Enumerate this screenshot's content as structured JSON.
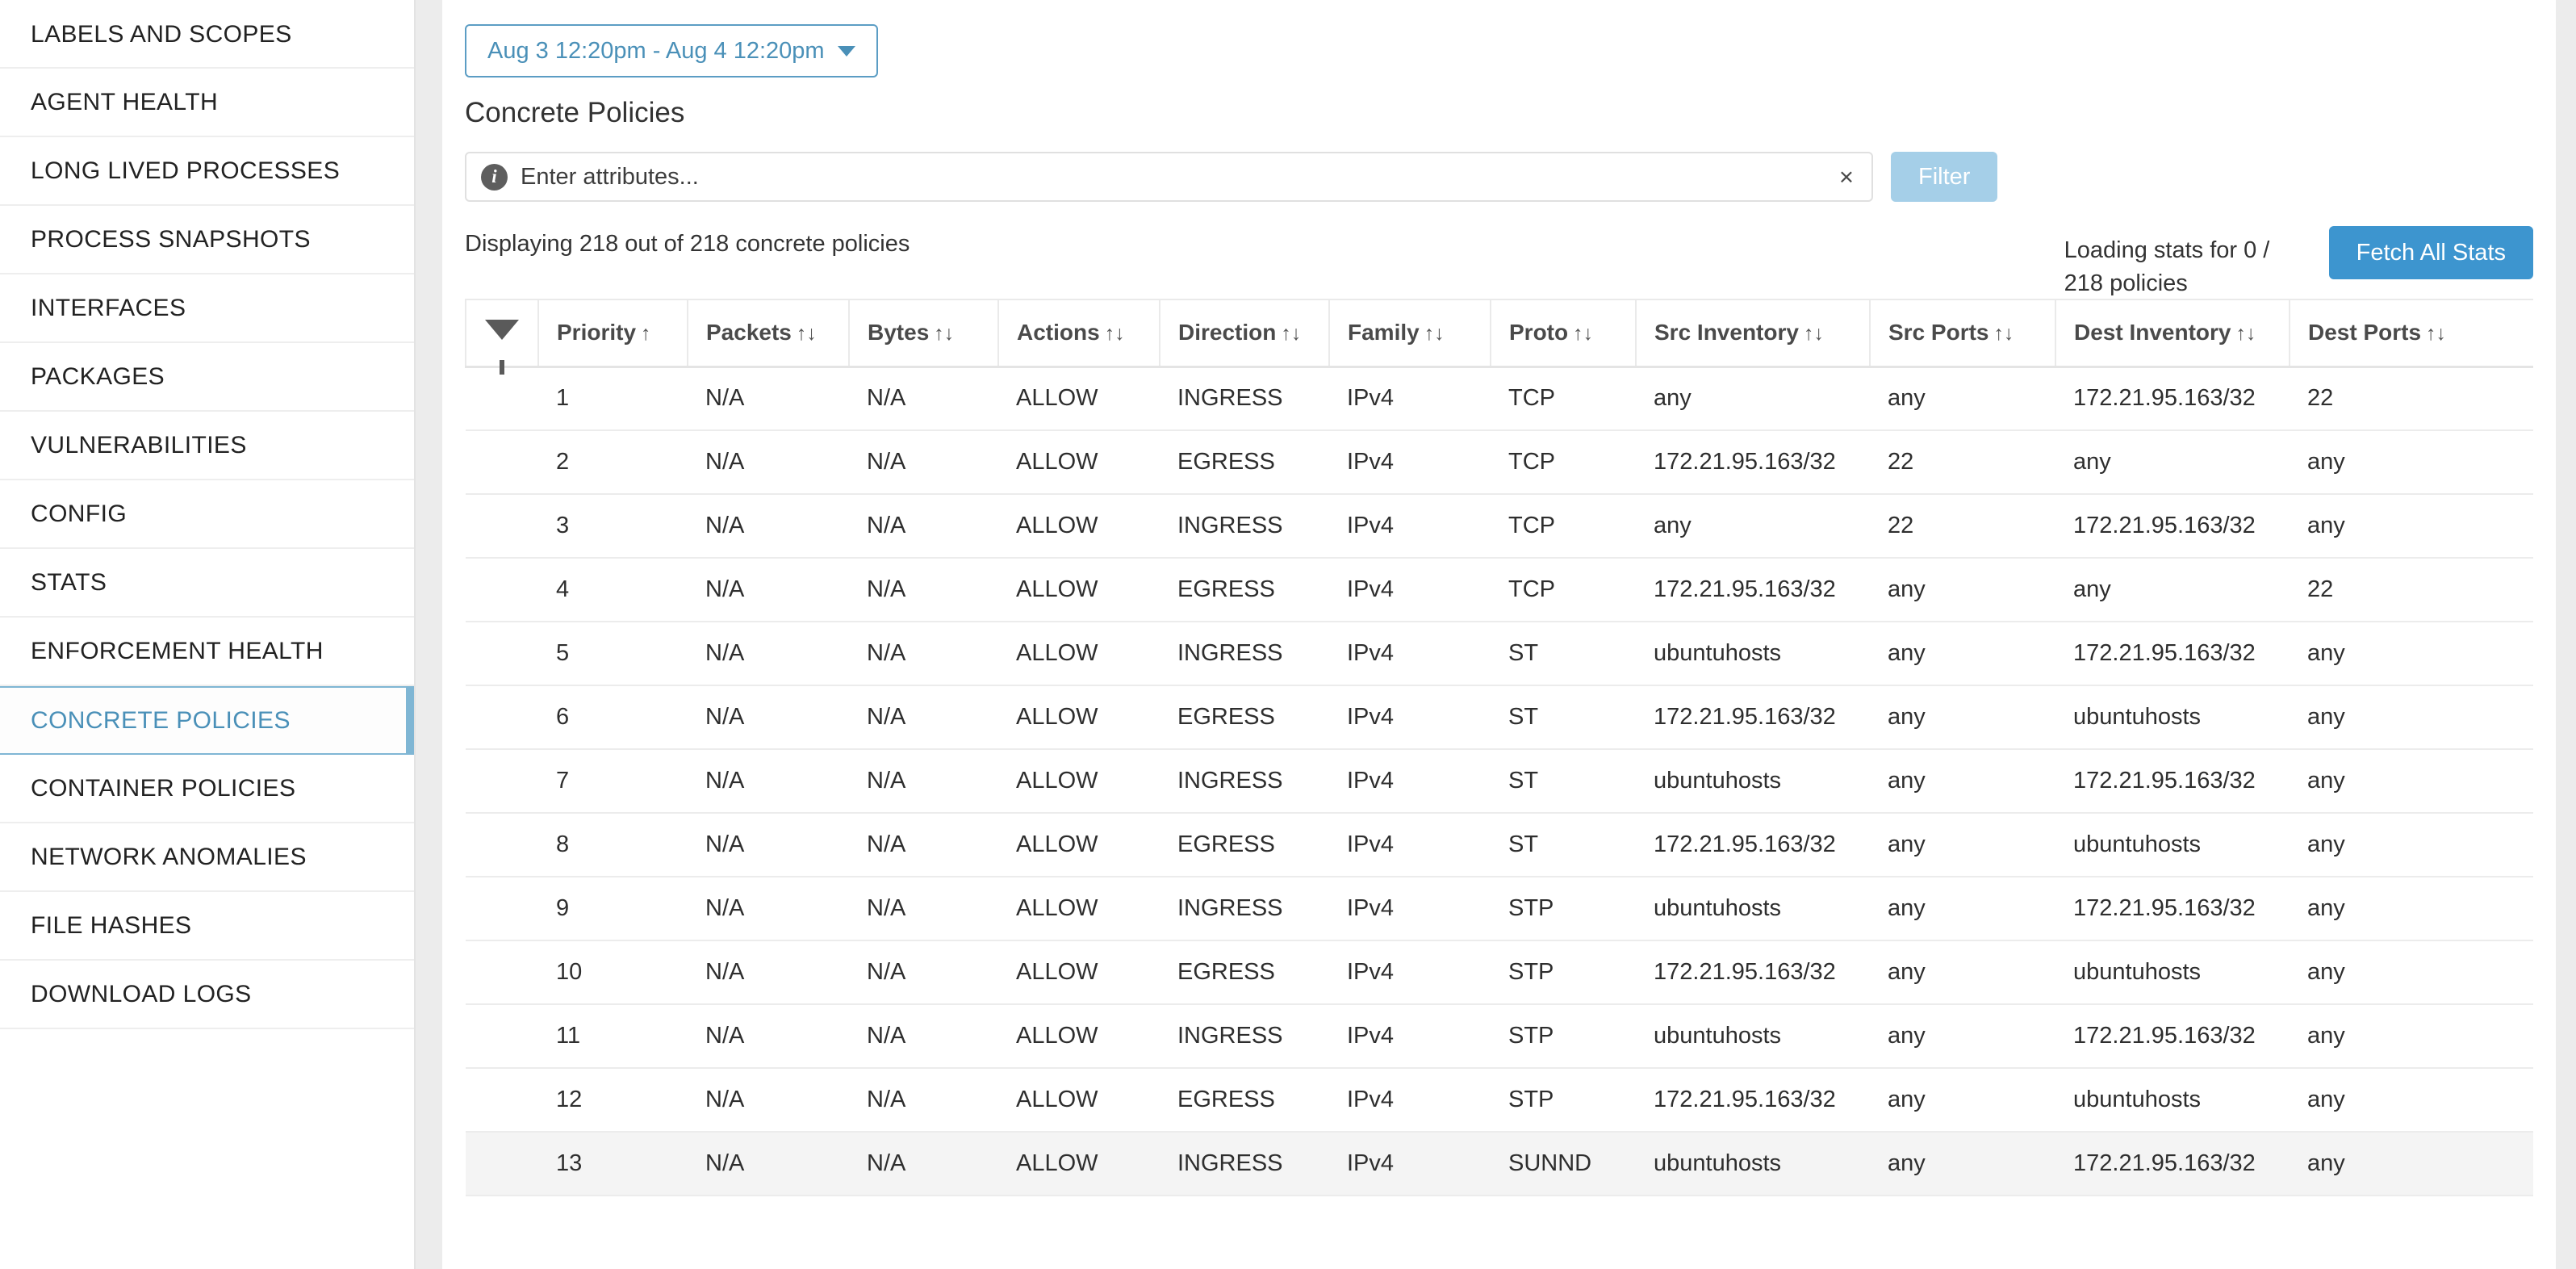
{
  "sidebar": {
    "items": [
      {
        "label": "LABELS AND SCOPES",
        "active": false
      },
      {
        "label": "AGENT HEALTH",
        "active": false
      },
      {
        "label": "LONG LIVED PROCESSES",
        "active": false
      },
      {
        "label": "PROCESS SNAPSHOTS",
        "active": false
      },
      {
        "label": "INTERFACES",
        "active": false
      },
      {
        "label": "PACKAGES",
        "active": false
      },
      {
        "label": "VULNERABILITIES",
        "active": false
      },
      {
        "label": "CONFIG",
        "active": false
      },
      {
        "label": "STATS",
        "active": false
      },
      {
        "label": "ENFORCEMENT HEALTH",
        "active": false
      },
      {
        "label": "CONCRETE POLICIES",
        "active": true
      },
      {
        "label": "CONTAINER POLICIES",
        "active": false
      },
      {
        "label": "NETWORK ANOMALIES",
        "active": false
      },
      {
        "label": "FILE HASHES",
        "active": false
      },
      {
        "label": "DOWNLOAD LOGS",
        "active": false
      }
    ]
  },
  "toolbar": {
    "date_range_label": "Aug 3 12:20pm - Aug 4 12:20pm",
    "caret_icon": "chevron-down-icon"
  },
  "page": {
    "title": "Concrete Policies"
  },
  "search": {
    "info_icon": "info-icon",
    "placeholder": "Enter attributes...",
    "value": "",
    "clear_icon": "×",
    "filter_button_label": "Filter"
  },
  "status": {
    "displaying_text": "Displaying 218 out of 218 concrete policies",
    "loading_text": "Loading stats for 0 / 218 policies",
    "fetch_button_label": "Fetch All Stats"
  },
  "table": {
    "filter_icon": "funnel-icon",
    "sort_asc_glyph": "↑",
    "sort_both_glyph": "↑↓",
    "columns": [
      {
        "label": "Priority",
        "sort": "asc"
      },
      {
        "label": "Packets",
        "sort": "both"
      },
      {
        "label": "Bytes",
        "sort": "both"
      },
      {
        "label": "Actions",
        "sort": "both"
      },
      {
        "label": "Direction",
        "sort": "both"
      },
      {
        "label": "Family",
        "sort": "both"
      },
      {
        "label": "Proto",
        "sort": "both"
      },
      {
        "label": "Src Inventory",
        "sort": "both"
      },
      {
        "label": "Src Ports",
        "sort": "both"
      },
      {
        "label": "Dest Inventory",
        "sort": "both"
      },
      {
        "label": "Dest Ports",
        "sort": "both"
      }
    ],
    "rows": [
      {
        "priority": "1",
        "packets": "N/A",
        "bytes": "N/A",
        "actions": "ALLOW",
        "direction": "INGRESS",
        "family": "IPv4",
        "proto": "TCP",
        "src_inventory": "any",
        "src_ports": "any",
        "dest_inventory": "172.21.95.163/32",
        "dest_ports": "22",
        "hovered": false
      },
      {
        "priority": "2",
        "packets": "N/A",
        "bytes": "N/A",
        "actions": "ALLOW",
        "direction": "EGRESS",
        "family": "IPv4",
        "proto": "TCP",
        "src_inventory": "172.21.95.163/32",
        "src_ports": "22",
        "dest_inventory": "any",
        "dest_ports": "any",
        "hovered": false
      },
      {
        "priority": "3",
        "packets": "N/A",
        "bytes": "N/A",
        "actions": "ALLOW",
        "direction": "INGRESS",
        "family": "IPv4",
        "proto": "TCP",
        "src_inventory": "any",
        "src_ports": "22",
        "dest_inventory": "172.21.95.163/32",
        "dest_ports": "any",
        "hovered": false
      },
      {
        "priority": "4",
        "packets": "N/A",
        "bytes": "N/A",
        "actions": "ALLOW",
        "direction": "EGRESS",
        "family": "IPv4",
        "proto": "TCP",
        "src_inventory": "172.21.95.163/32",
        "src_ports": "any",
        "dest_inventory": "any",
        "dest_ports": "22",
        "hovered": false
      },
      {
        "priority": "5",
        "packets": "N/A",
        "bytes": "N/A",
        "actions": "ALLOW",
        "direction": "INGRESS",
        "family": "IPv4",
        "proto": "ST",
        "src_inventory": "ubuntuhosts",
        "src_ports": "any",
        "dest_inventory": "172.21.95.163/32",
        "dest_ports": "any",
        "hovered": false
      },
      {
        "priority": "6",
        "packets": "N/A",
        "bytes": "N/A",
        "actions": "ALLOW",
        "direction": "EGRESS",
        "family": "IPv4",
        "proto": "ST",
        "src_inventory": "172.21.95.163/32",
        "src_ports": "any",
        "dest_inventory": "ubuntuhosts",
        "dest_ports": "any",
        "hovered": false
      },
      {
        "priority": "7",
        "packets": "N/A",
        "bytes": "N/A",
        "actions": "ALLOW",
        "direction": "INGRESS",
        "family": "IPv4",
        "proto": "ST",
        "src_inventory": "ubuntuhosts",
        "src_ports": "any",
        "dest_inventory": "172.21.95.163/32",
        "dest_ports": "any",
        "hovered": false
      },
      {
        "priority": "8",
        "packets": "N/A",
        "bytes": "N/A",
        "actions": "ALLOW",
        "direction": "EGRESS",
        "family": "IPv4",
        "proto": "ST",
        "src_inventory": "172.21.95.163/32",
        "src_ports": "any",
        "dest_inventory": "ubuntuhosts",
        "dest_ports": "any",
        "hovered": false
      },
      {
        "priority": "9",
        "packets": "N/A",
        "bytes": "N/A",
        "actions": "ALLOW",
        "direction": "INGRESS",
        "family": "IPv4",
        "proto": "STP",
        "src_inventory": "ubuntuhosts",
        "src_ports": "any",
        "dest_inventory": "172.21.95.163/32",
        "dest_ports": "any",
        "hovered": false
      },
      {
        "priority": "10",
        "packets": "N/A",
        "bytes": "N/A",
        "actions": "ALLOW",
        "direction": "EGRESS",
        "family": "IPv4",
        "proto": "STP",
        "src_inventory": "172.21.95.163/32",
        "src_ports": "any",
        "dest_inventory": "ubuntuhosts",
        "dest_ports": "any",
        "hovered": false
      },
      {
        "priority": "11",
        "packets": "N/A",
        "bytes": "N/A",
        "actions": "ALLOW",
        "direction": "INGRESS",
        "family": "IPv4",
        "proto": "STP",
        "src_inventory": "ubuntuhosts",
        "src_ports": "any",
        "dest_inventory": "172.21.95.163/32",
        "dest_ports": "any",
        "hovered": false
      },
      {
        "priority": "12",
        "packets": "N/A",
        "bytes": "N/A",
        "actions": "ALLOW",
        "direction": "EGRESS",
        "family": "IPv4",
        "proto": "STP",
        "src_inventory": "172.21.95.163/32",
        "src_ports": "any",
        "dest_inventory": "ubuntuhosts",
        "dest_ports": "any",
        "hovered": false
      },
      {
        "priority": "13",
        "packets": "N/A",
        "bytes": "N/A",
        "actions": "ALLOW",
        "direction": "INGRESS",
        "family": "IPv4",
        "proto": "SUNND",
        "src_inventory": "ubuntuhosts",
        "src_ports": "any",
        "dest_inventory": "172.21.95.163/32",
        "dest_ports": "any",
        "hovered": true
      }
    ]
  },
  "colors": {
    "accent": "#3d95cf",
    "accent_light": "#a5cfe8",
    "active_nav": "#4a90b8",
    "page_bg": "#ececec"
  }
}
